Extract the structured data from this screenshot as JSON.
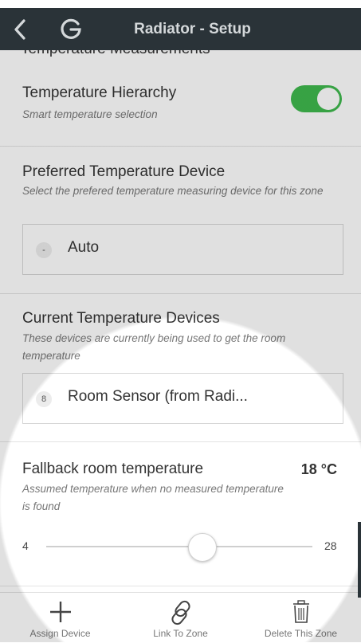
{
  "appbar": {
    "title": "Radiator - Setup",
    "back_icon": "chevron-left-icon",
    "logo_icon": "g-logo-icon"
  },
  "cut_section_header": "Temperature Measurements",
  "hierarchy": {
    "title": "Temperature Hierarchy",
    "subtitle": "Smart temperature selection",
    "toggle_on": true,
    "toggle_color": "#3fb84d"
  },
  "preferred": {
    "title": "Preferred Temperature Device",
    "subtitle": "Select the prefered temperature measuring device for this zone",
    "badge": "-",
    "value": "Auto"
  },
  "current": {
    "title": "Current Temperature Devices",
    "subtitle": "These devices are currently being used to get the room temperature",
    "badge": "8",
    "value": "Room Sensor (from Radi..."
  },
  "fallback": {
    "title": "Fallback room temperature",
    "value": "18 °C",
    "subtitle": "Assumed temperature when no measured temperature is found",
    "slider_min": "4",
    "slider_max": "28",
    "slider_value": 18
  },
  "bottom": {
    "assign_label": "Assign Device",
    "link_label": "Link To Zone",
    "delete_label": "Delete This Zone"
  },
  "colors": {
    "appbar_bg": "#2a3338",
    "accent_green": "#3fb84d"
  }
}
